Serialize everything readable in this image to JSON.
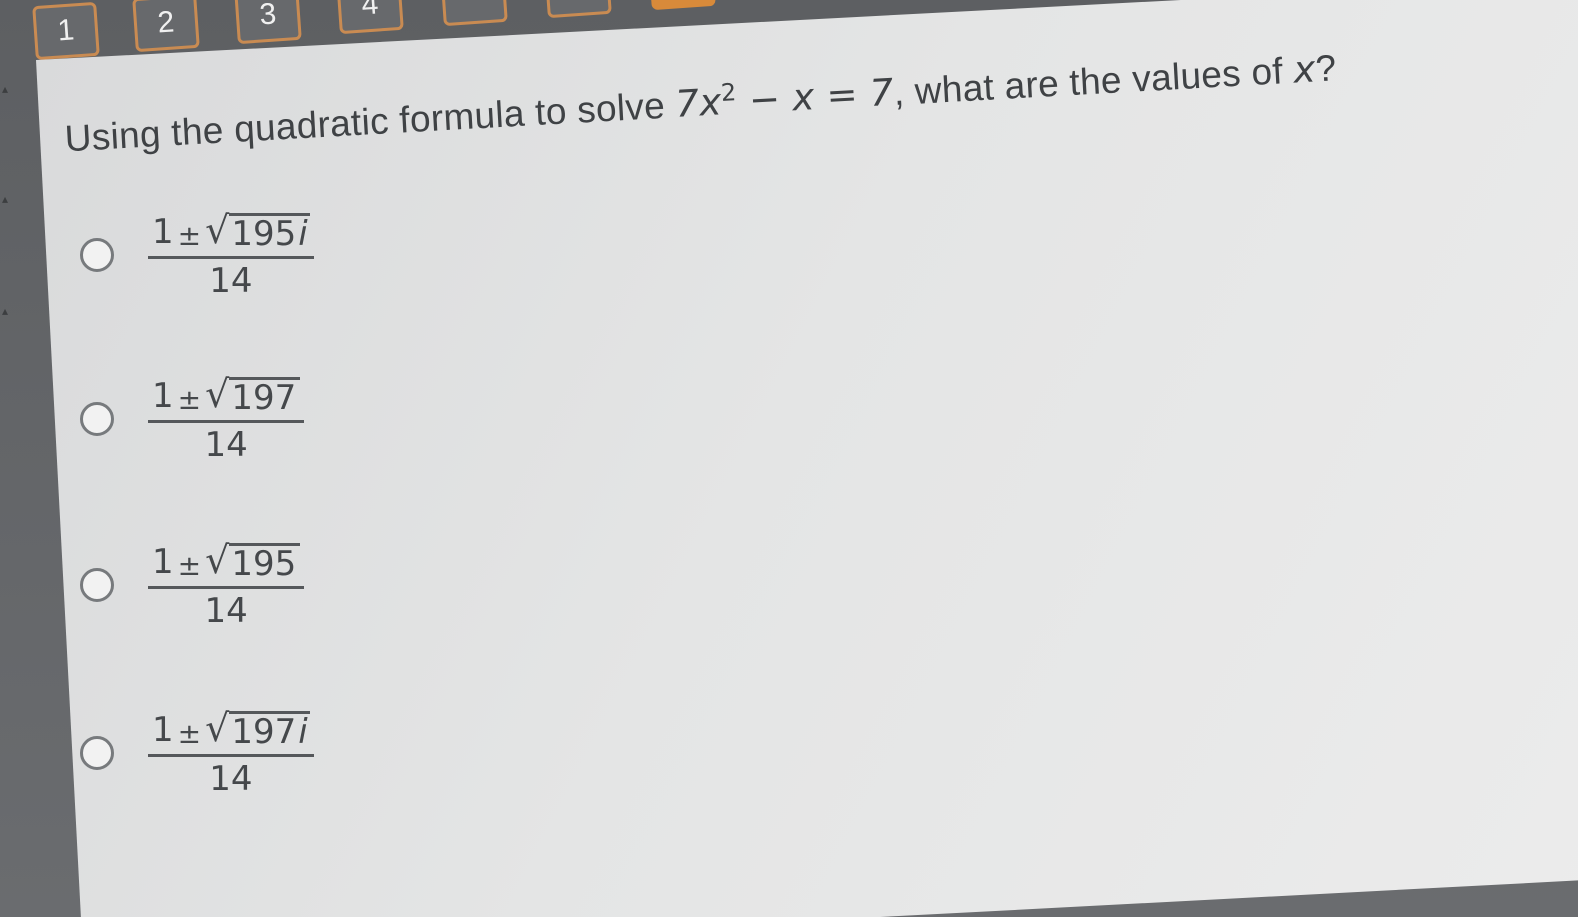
{
  "nav": {
    "questions": [
      {
        "label": "1",
        "state": "default"
      },
      {
        "label": "2",
        "state": "default"
      },
      {
        "label": "3",
        "state": "default"
      },
      {
        "label": "4",
        "state": "default"
      },
      {
        "label": "",
        "state": "default"
      },
      {
        "label": "",
        "state": "default"
      },
      {
        "label": "",
        "state": "active"
      }
    ],
    "accent_color": "#d88a3a"
  },
  "question": {
    "prefix": "Using the quadratic formula to solve",
    "coef": "7",
    "var1": "x",
    "exp": "2",
    "rest": " − x = 7",
    "suffix": ", what are the values of",
    "var2": "x",
    "end": "?"
  },
  "options": [
    {
      "one": "1",
      "pm": "±",
      "radicand": "195",
      "imag": "i",
      "den": "14"
    },
    {
      "one": "1",
      "pm": "±",
      "radicand": "197",
      "imag": "",
      "den": "14"
    },
    {
      "one": "1",
      "pm": "±",
      "radicand": "195",
      "imag": "",
      "den": "14"
    },
    {
      "one": "1",
      "pm": "±",
      "radicand": "197",
      "imag": "i",
      "den": "14"
    }
  ]
}
